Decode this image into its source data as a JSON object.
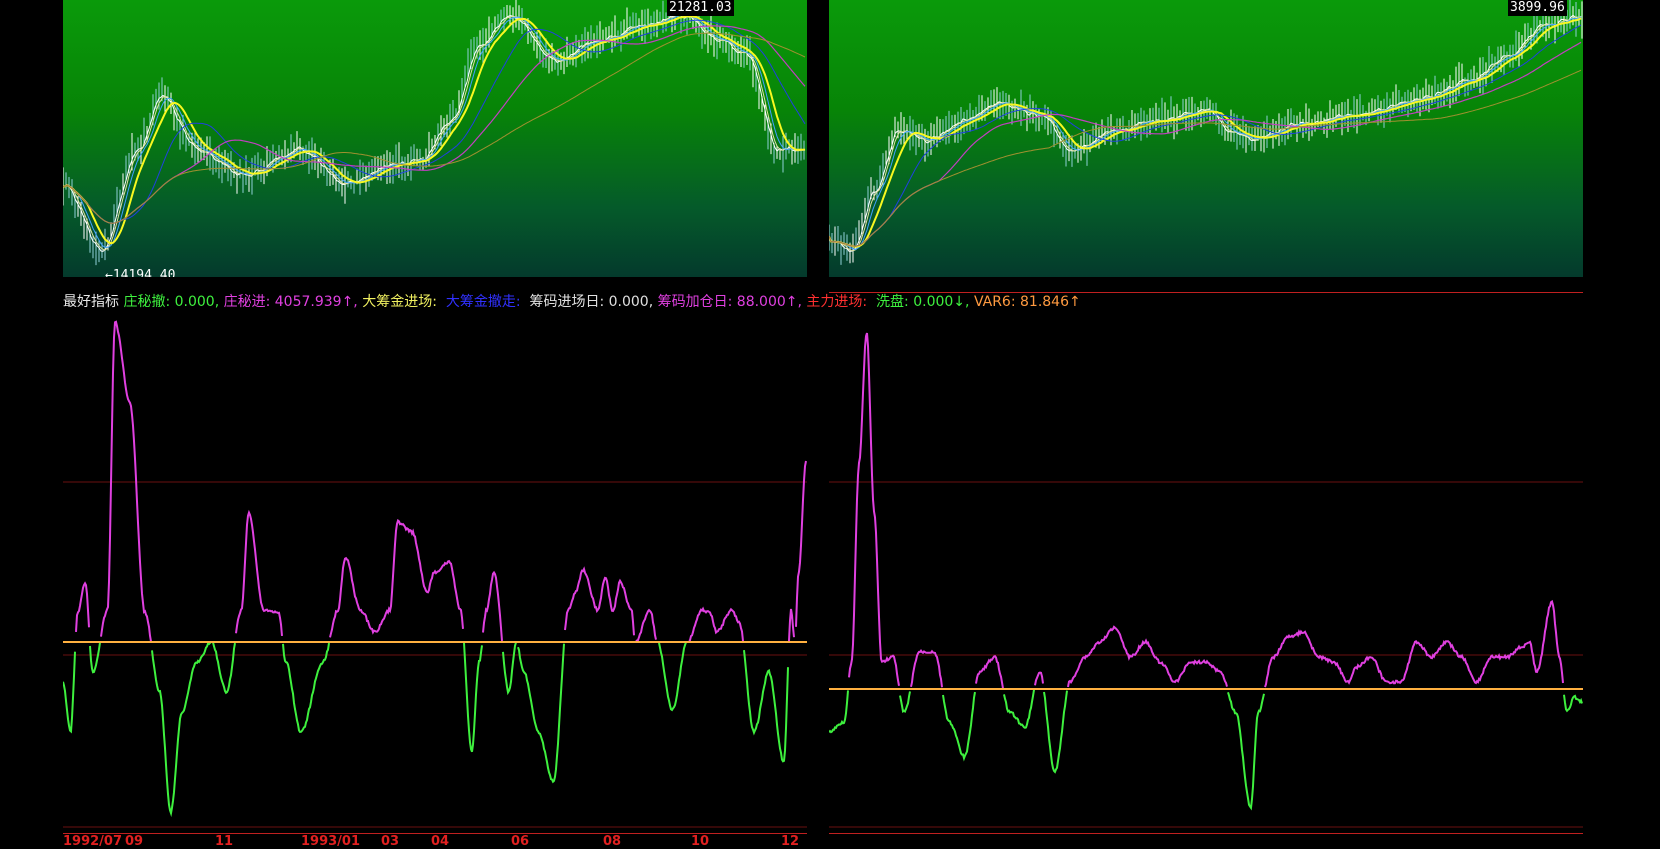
{
  "left_price": {
    "high_label": "21281.03",
    "low_label": "←14194.40"
  },
  "right_price": {
    "high_label": "3899.96"
  },
  "indicator_bar": {
    "name": "最好指标",
    "items": [
      {
        "text": "庄秘撤: 0.000,",
        "color": "#3ef03e"
      },
      {
        "text": "庄秘进: 4057.939↑,",
        "color": "#e040e0"
      },
      {
        "text": "大筹金进场: ",
        "color": "#f0f060"
      },
      {
        "text": "大筹金撤走: ",
        "color": "#3030ff"
      },
      {
        "text": "筹码进场日: 0.000,",
        "color": "#e0e0e0"
      },
      {
        "text": "筹码加仓日: 88.000↑,",
        "color": "#e040e0"
      },
      {
        "text": "主力进场: ",
        "color": "#ff3030"
      },
      {
        "text": "洗盘: 0.000↓,",
        "color": "#3ef03e"
      },
      {
        "text": "VAR6: 81.846↑",
        "color": "#ff9a40"
      }
    ]
  },
  "date_axis": [
    {
      "label": "1992/07"
    },
    {
      "label": "09"
    },
    {
      "label": "11"
    },
    {
      "label": "1993/01"
    },
    {
      "label": "03"
    },
    {
      "label": "04"
    },
    {
      "label": "06"
    },
    {
      "label": "08"
    },
    {
      "label": "10"
    },
    {
      "label": "12"
    }
  ],
  "colors": {
    "up": "#e040e0",
    "down": "#3ef03e",
    "baseline": "#ffb040",
    "ma_yellow": "#f8f820",
    "ma_blue": "#2040e0",
    "ma_purple": "#c040c0",
    "ma_olive": "#a09030"
  }
}
